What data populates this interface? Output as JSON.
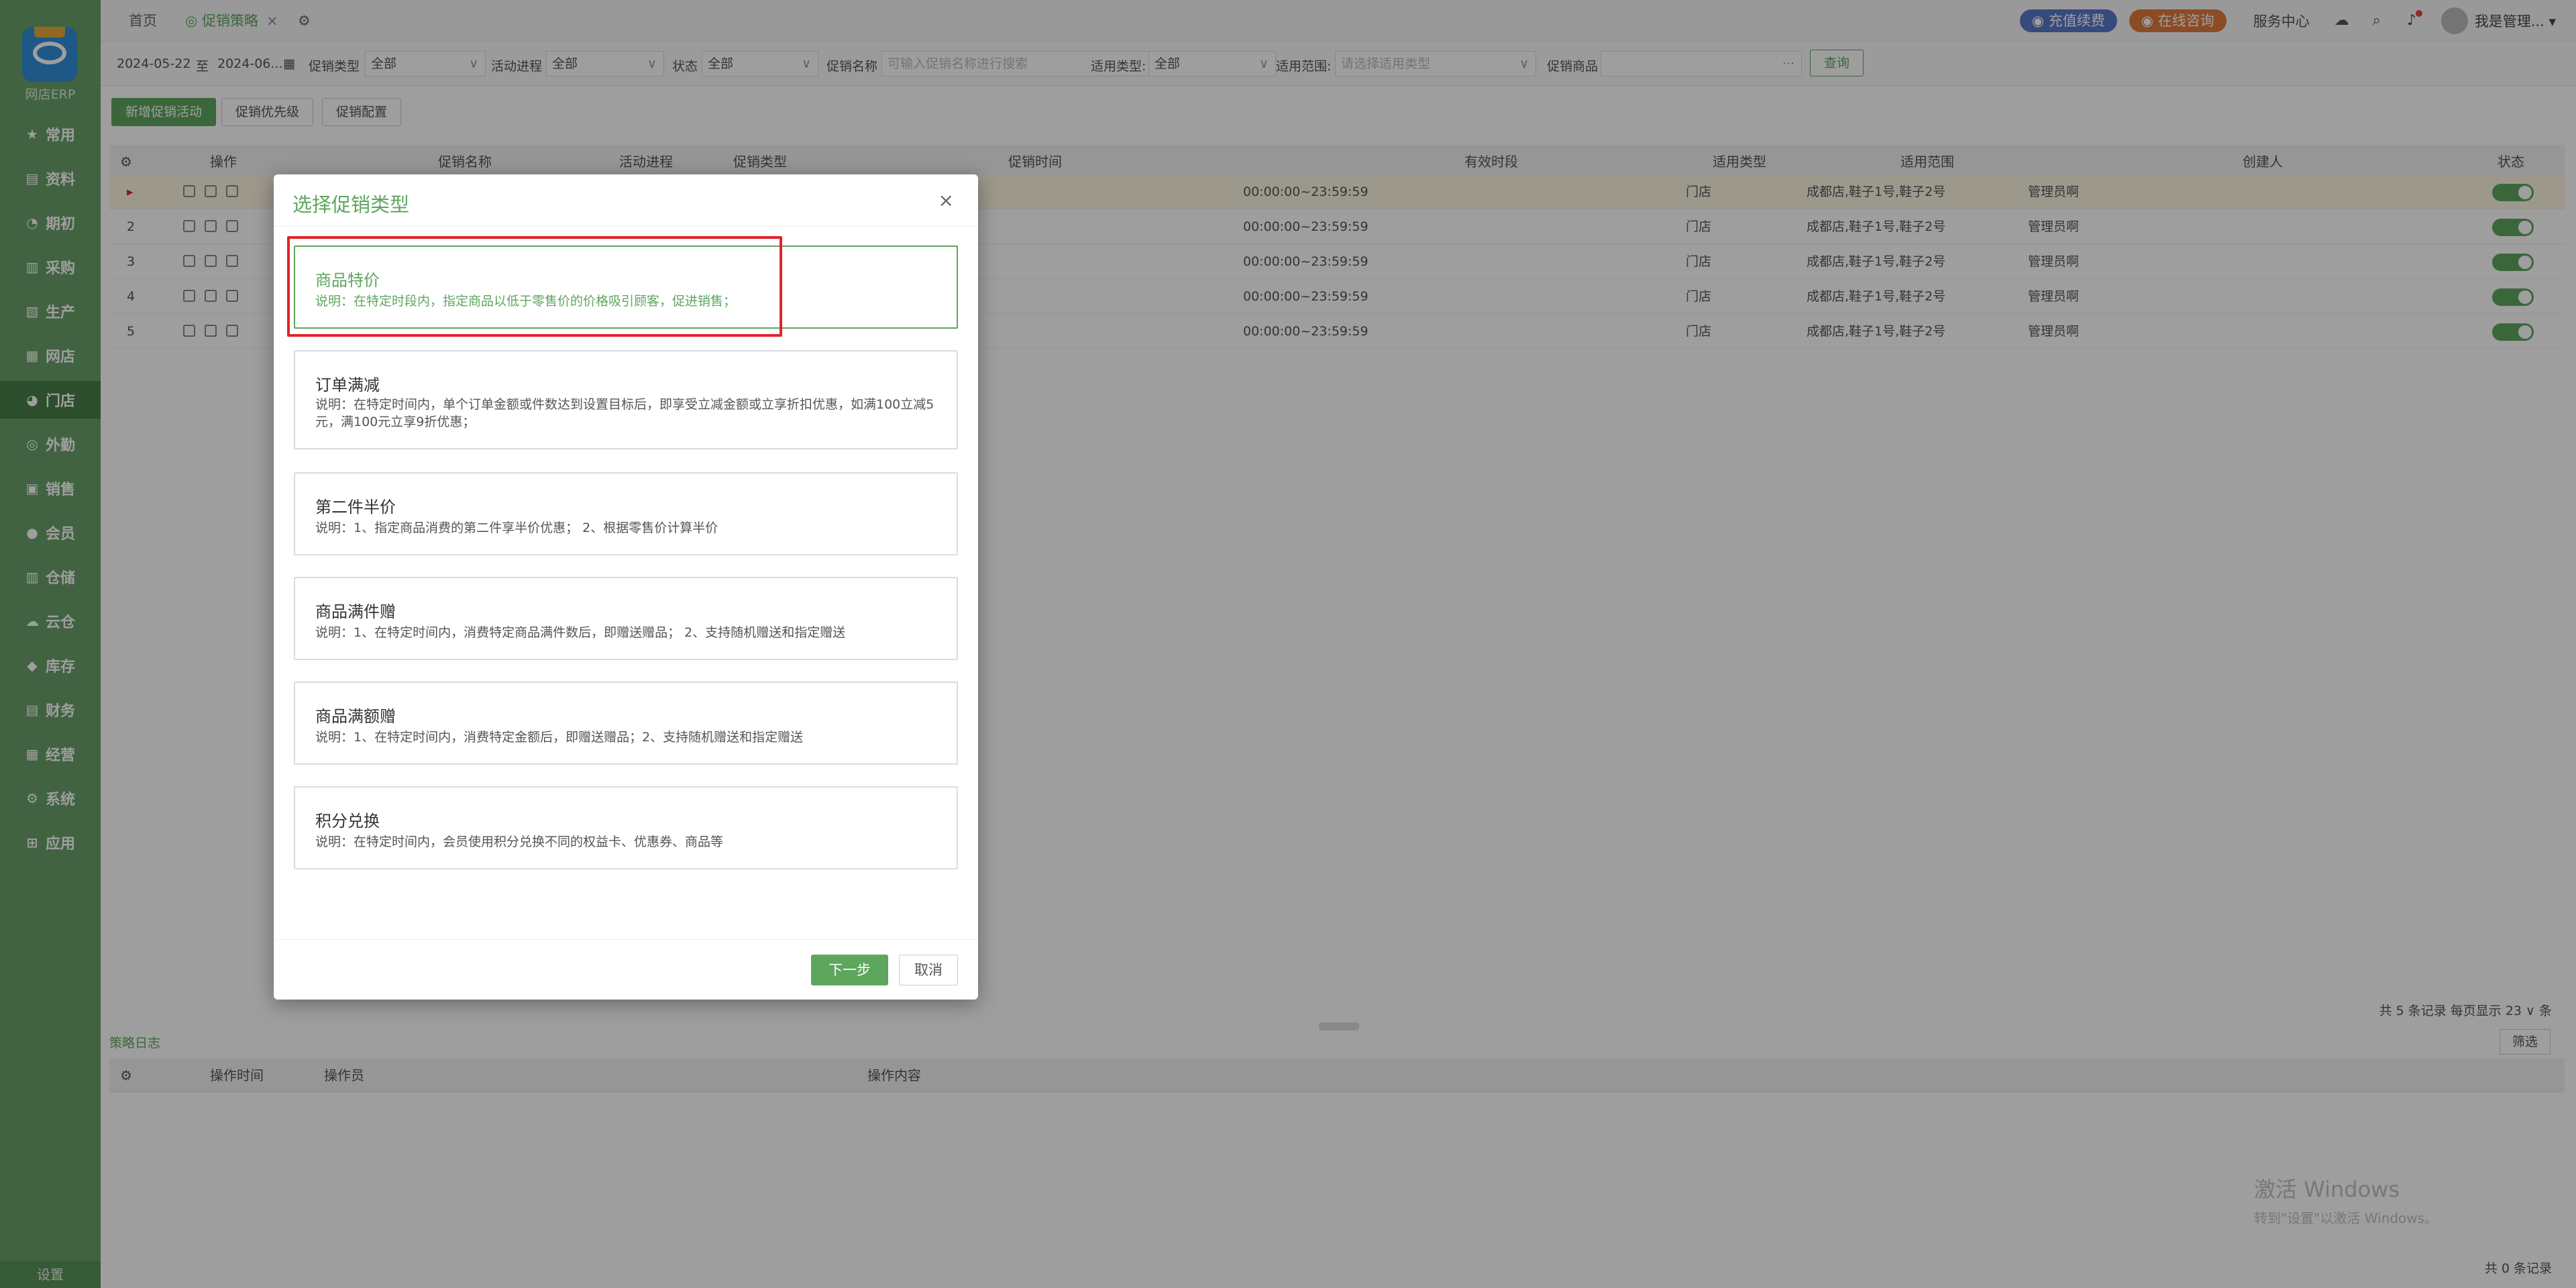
{
  "sidebar": {
    "logo_text": "网店ERP",
    "items": [
      {
        "label": "常用",
        "icon": "★"
      },
      {
        "label": "资料",
        "icon": "▤"
      },
      {
        "label": "期初",
        "icon": "◔"
      },
      {
        "label": "采购",
        "icon": "▥"
      },
      {
        "label": "生产",
        "icon": "▧"
      },
      {
        "label": "网店",
        "icon": "▦"
      },
      {
        "label": "门店",
        "icon": "◕"
      },
      {
        "label": "外勤",
        "icon": "◎"
      },
      {
        "label": "销售",
        "icon": "▣"
      },
      {
        "label": "会员",
        "icon": "●"
      },
      {
        "label": "仓储",
        "icon": "▥"
      },
      {
        "label": "云仓",
        "icon": "☁"
      },
      {
        "label": "库存",
        "icon": "◆"
      },
      {
        "label": "财务",
        "icon": "▤"
      },
      {
        "label": "经营",
        "icon": "▦"
      },
      {
        "label": "系统",
        "icon": "⚙"
      },
      {
        "label": "应用",
        "icon": "⊞"
      }
    ],
    "bottom_label": "设置"
  },
  "topbar": {
    "tab_home": "首页",
    "tab_active": "促销策略",
    "recharge": "充值续费",
    "consult": "在线咨询",
    "service": "服务中心",
    "user": "我是管理..."
  },
  "filters": {
    "date_from": "2024-05-22",
    "date_sep": "至",
    "date_to": "2024-06...",
    "promo_type_label": "促销类型",
    "promo_type_value": "全部",
    "progress_label": "活动进程",
    "progress_value": "全部",
    "status_label": "状态",
    "status_value": "全部",
    "name_label": "促销名称",
    "name_placeholder": "可输入促销名称进行搜索",
    "apply_type_label": "适用类型:",
    "apply_type_value": "全部",
    "scope_label": "适用范围:",
    "scope_placeholder": "请选择适用类型",
    "goods_label": "促销商品",
    "query_btn": "查询"
  },
  "actions": {
    "new_btn": "新增促销活动",
    "priority_btn": "促销优先级",
    "config_btn": "促销配置"
  },
  "table": {
    "headers": [
      "操作",
      "促销名称",
      "活动进程",
      "促销类型",
      "促销时间",
      "有效时段",
      "适用类型",
      "适用范围",
      "创建人",
      "状态"
    ],
    "rows": [
      {
        "no": "▸",
        "time": "00:00:00~23:59:59",
        "type": "门店",
        "scope": "成都店,鞋子1号,鞋子2号",
        "creator": "管理员啊"
      },
      {
        "no": "2",
        "time": "00:00:00~23:59:59",
        "type": "门店",
        "scope": "成都店,鞋子1号,鞋子2号",
        "creator": "管理员啊"
      },
      {
        "no": "3",
        "time": "00:00:00~23:59:59",
        "type": "门店",
        "scope": "成都店,鞋子1号,鞋子2号",
        "creator": "管理员啊"
      },
      {
        "no": "4",
        "time": "00:00:00~23:59:59",
        "type": "门店",
        "scope": "成都店,鞋子1号,鞋子2号",
        "creator": "管理员啊"
      },
      {
        "no": "5",
        "time": "00:00:00~23:59:59",
        "type": "门店",
        "scope": "成都店,鞋子1号,鞋子2号",
        "creator": "管理员啊"
      }
    ],
    "pager": "共 5 条记录 每页显示 23 ∨ 条"
  },
  "log": {
    "title": "策略日志",
    "filter_btn": "筛选",
    "headers": [
      "操作时间",
      "操作员",
      "操作内容"
    ],
    "total": "共 0 条记录"
  },
  "watermark": {
    "line1": "激活 Windows",
    "line2": "转到\"设置\"以激活 Windows。"
  },
  "modal": {
    "title": "选择促销类型",
    "close": "×",
    "options": [
      {
        "title": "商品特价",
        "desc": "说明：在特定时段内，指定商品以低于零售价的价格吸引顾客，促进销售；"
      },
      {
        "title": "订单满减",
        "desc": "说明：在特定时间内，单个订单金额或件数达到设置目标后，即享受立减金额或立享折扣优惠，如满100立减5元，满100元立享9折优惠；"
      },
      {
        "title": "第二件半价",
        "desc": "说明：1、指定商品消费的第二件享半价优惠； 2、根据零售价计算半价"
      },
      {
        "title": "商品满件赠",
        "desc": "说明：1、在特定时间内，消费特定商品满件数后，即赠送赠品； 2、支持随机赠送和指定赠送"
      },
      {
        "title": "商品满额赠",
        "desc": "说明：1、在特定时间内，消费特定金额后，即赠送赠品；2、支持随机赠送和指定赠送"
      },
      {
        "title": "积分兑换",
        "desc": "说明：在特定时间内，会员使用积分兑换不同的权益卡、优惠券、商品等"
      }
    ],
    "next_btn": "下一步",
    "cancel_btn": "取消"
  },
  "colors": {
    "accent": "#5ea65e",
    "sidebar": "#6aa06a",
    "highlight": "#e0242a"
  }
}
